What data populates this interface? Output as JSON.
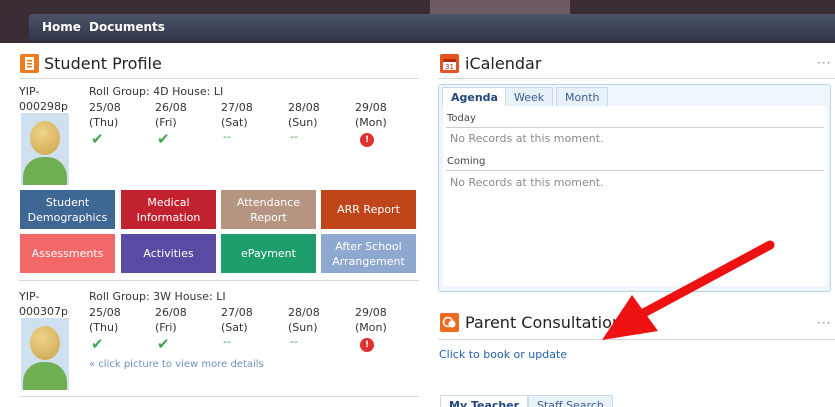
{
  "nav": {
    "home": "Home",
    "documents": "Documents"
  },
  "student_profile": {
    "title": "Student Profile",
    "students": [
      {
        "id_line1": "YIP-",
        "id_line2": "000298p",
        "group_line": "Roll Group: 4D  House: LI",
        "days": [
          {
            "date": "25/08",
            "dow": "(Thu)",
            "status": "✔"
          },
          {
            "date": "26/08",
            "dow": "(Fri)",
            "status": "✔"
          },
          {
            "date": "27/08",
            "dow": "(Sat)",
            "status": "--"
          },
          {
            "date": "28/08",
            "dow": "(Sun)",
            "status": "--"
          },
          {
            "date": "29/08",
            "dow": "(Mon)",
            "status": "!"
          }
        ]
      },
      {
        "id_line1": "YIP-",
        "id_line2": "000307p",
        "group_line": "Roll Group: 3W  House: LI",
        "days": [
          {
            "date": "25/08",
            "dow": "(Thu)",
            "status": "✔"
          },
          {
            "date": "26/08",
            "dow": "(Fri)",
            "status": "✔"
          },
          {
            "date": "27/08",
            "dow": "(Sat)",
            "status": "--"
          },
          {
            "date": "28/08",
            "dow": "(Sun)",
            "status": "--"
          },
          {
            "date": "29/08",
            "dow": "(Mon)",
            "status": "!"
          }
        ],
        "hint": "click picture to view more details"
      }
    ],
    "tiles": [
      {
        "l1": "Student",
        "l2": "Demographics",
        "color": "#3f6793"
      },
      {
        "l1": "Medical",
        "l2": "Information",
        "color": "#c22230"
      },
      {
        "l1": "Attendance",
        "l2": "Report",
        "color": "#b59481"
      },
      {
        "l1": "ARR Report",
        "l2": "",
        "color": "#c1451b"
      },
      {
        "l1": "Assessments",
        "l2": "",
        "color": "#f26868"
      },
      {
        "l1": "Activities",
        "l2": "",
        "color": "#5b4aa3"
      },
      {
        "l1": "ePayment",
        "l2": "",
        "color": "#1e9e6b"
      },
      {
        "l1": "After School",
        "l2": "Arrangement",
        "color": "#8ea8cf"
      }
    ]
  },
  "icalendar": {
    "title": "iCalendar",
    "tabs": [
      "Agenda",
      "Week",
      "Month"
    ],
    "today_label": "Today",
    "today_msg": "No Records at this moment.",
    "coming_label": "Coming",
    "coming_msg": "No Records at this moment."
  },
  "parent_consultation": {
    "title": "Parent Consultation",
    "link": "Click to book or update",
    "tabs": [
      "My Teacher",
      "Staff Search"
    ]
  },
  "more_menu": "···"
}
